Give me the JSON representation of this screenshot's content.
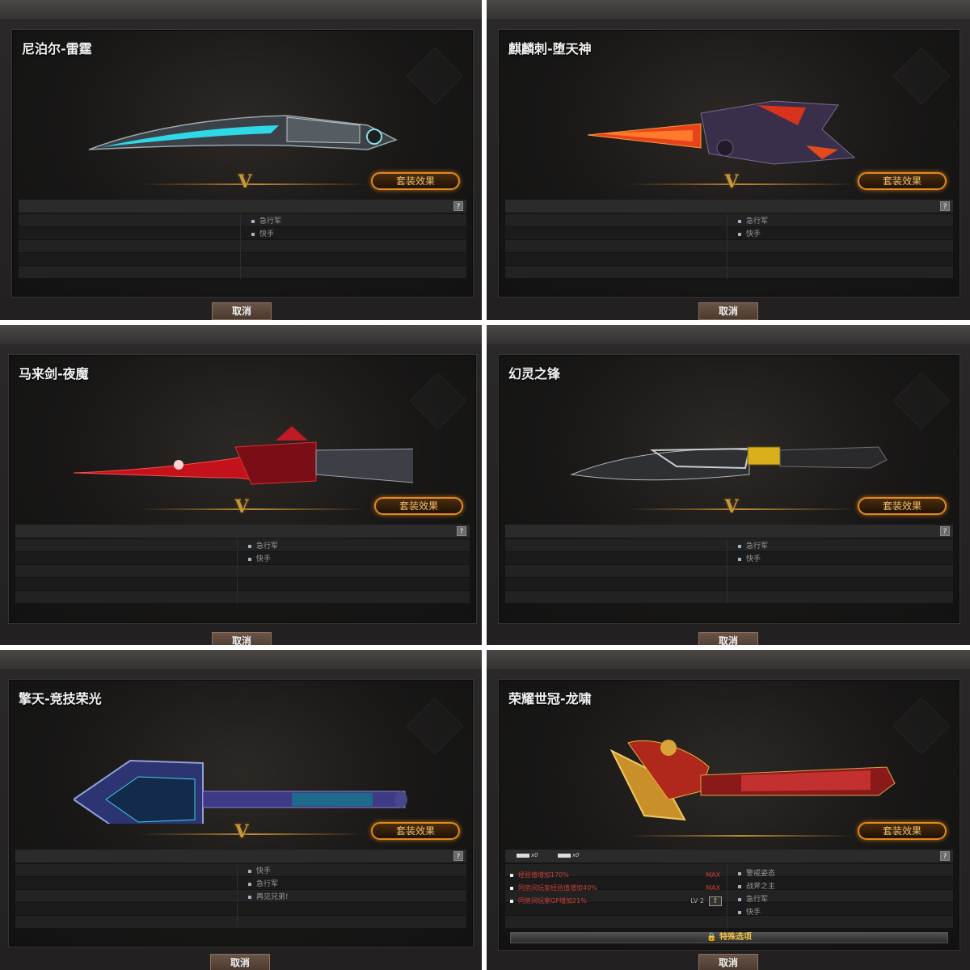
{
  "cells": [
    {
      "title": "尼泊尔-雷霆",
      "bullets": [
        "急行军",
        "快手"
      ],
      "set_label": "套装效果",
      "cancel_label": "取消",
      "help": "?",
      "v": "V"
    },
    {
      "title": "麒麟刺-堕天神",
      "bullets": [
        "急行军",
        "快手"
      ],
      "set_label": "套装效果",
      "cancel_label": "取消",
      "help": "?",
      "v": "V"
    },
    {
      "title": "马来剑-夜魔",
      "bullets": [
        "急行军",
        "快手"
      ],
      "set_label": "套装效果",
      "cancel_label": "取消",
      "help": "?",
      "v": "V"
    },
    {
      "title": "幻灵之锋",
      "bullets": [
        "急行军",
        "快手"
      ],
      "set_label": "套装效果",
      "cancel_label": "取消",
      "help": "?",
      "v": "V"
    },
    {
      "title": "擎天-竞技荣光",
      "bullets": [
        "快手",
        "急行军",
        "再见兄弟!"
      ],
      "set_label": "套装效果",
      "cancel_label": "取消",
      "help": "?",
      "v": "V"
    },
    {
      "title": "荣耀世冠-龙啸",
      "bullets": [
        "警戒姿态",
        "战斧之主",
        "急行军",
        "快手"
      ],
      "set_label": "套装效果",
      "cancel_label": "取消",
      "help": "?",
      "v": "",
      "mini": [
        "x0",
        "x0"
      ],
      "stats": [
        {
          "text": "经验值增加170%",
          "level": "MAX"
        },
        {
          "text": "同房间玩家经验值增加40%",
          "level": "MAX"
        },
        {
          "text": "同房间玩家GP增加21%",
          "level": "LV 2"
        }
      ],
      "special_label": "特殊选项"
    }
  ],
  "colors": {
    "accent": "#e08a1f",
    "gold": "#c8963e",
    "stat_red": "#c9413a"
  }
}
